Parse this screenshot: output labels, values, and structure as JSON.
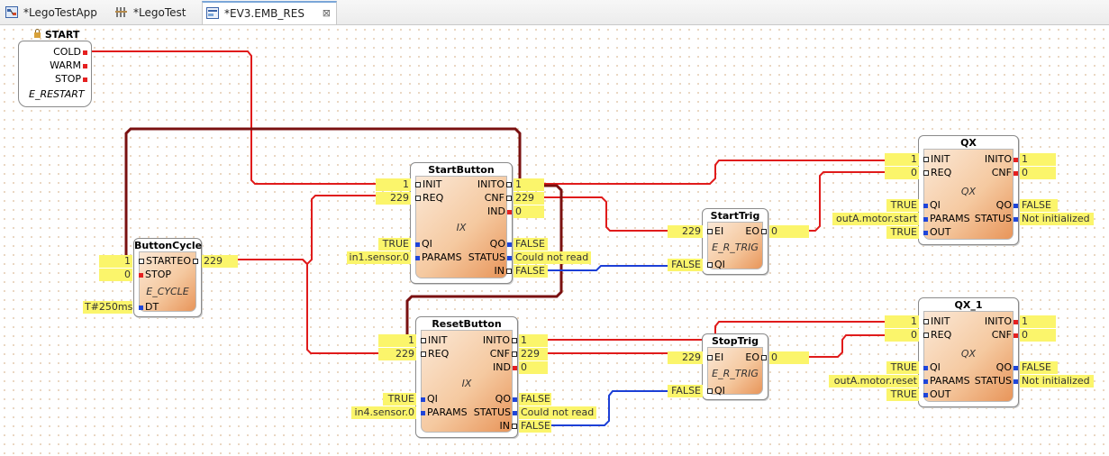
{
  "tabs": [
    {
      "label": "*LegoTestApp",
      "icon": "application-icon"
    },
    {
      "label": "*LegoTest",
      "icon": "system-icon"
    },
    {
      "label": "*EV3.EMB_RES",
      "icon": "resource-icon",
      "close": "⊠"
    }
  ],
  "start_block": {
    "title": "START",
    "ports": [
      "COLD",
      "WARM",
      "STOP"
    ],
    "type": "E_RESTART"
  },
  "blocks": {
    "button_cycle": {
      "title": "ButtonCycle",
      "type": "E_CYCLE",
      "inputs": [
        "START",
        "STOP",
        "DT"
      ],
      "outputs": [
        "EO"
      ],
      "values": {
        "start": "1",
        "stop": "0",
        "dt": "T#250ms",
        "eo": "229"
      }
    },
    "start_button": {
      "title": "StartButton",
      "type": "IX",
      "inputs": [
        "INIT",
        "REQ",
        "QI",
        "PARAMS"
      ],
      "outputs": [
        "INITO",
        "CNF",
        "IND",
        "QO",
        "STATUS",
        "IN"
      ],
      "values": {
        "init": "1",
        "req": "229",
        "qi": "TRUE",
        "params": "in1.sensor.0",
        "inito": "1",
        "cnf": "229",
        "ind": "0",
        "qo": "FALSE",
        "status": "Could not read",
        "in": "FALSE"
      }
    },
    "reset_button": {
      "title": "ResetButton",
      "type": "IX",
      "inputs": [
        "INIT",
        "REQ",
        "QI",
        "PARAMS"
      ],
      "outputs": [
        "INITO",
        "CNF",
        "IND",
        "QO",
        "STATUS",
        "IN"
      ],
      "values": {
        "init": "1",
        "req": "229",
        "qi": "TRUE",
        "params": "in4.sensor.0",
        "inito": "1",
        "cnf": "229",
        "ind": "0",
        "qo": "FALSE",
        "status": "Could not read",
        "in": "FALSE"
      }
    },
    "start_trig": {
      "title": "StartTrig",
      "type": "E_R_TRIG",
      "inputs": [
        "EI",
        "QI"
      ],
      "outputs": [
        "EO"
      ],
      "values": {
        "ei": "229",
        "qi": "FALSE",
        "eo": "0"
      }
    },
    "stop_trig": {
      "title": "StopTrig",
      "type": "E_R_TRIG",
      "inputs": [
        "EI",
        "QI"
      ],
      "outputs": [
        "EO"
      ],
      "values": {
        "ei": "229",
        "qi": "FALSE",
        "eo": "0"
      }
    },
    "qx": {
      "title": "QX",
      "type": "QX",
      "inputs": [
        "INIT",
        "REQ",
        "QI",
        "PARAMS",
        "OUT"
      ],
      "outputs": [
        "INITO",
        "CNF",
        "QO",
        "STATUS"
      ],
      "values": {
        "init": "1",
        "req": "0",
        "qi": "TRUE",
        "params": "outA.motor.start",
        "out": "TRUE",
        "inito": "1",
        "cnf": "0",
        "qo": "FALSE",
        "status": "Not initialized"
      }
    },
    "qx_1": {
      "title": "QX_1",
      "type": "QX",
      "inputs": [
        "INIT",
        "REQ",
        "QI",
        "PARAMS",
        "OUT"
      ],
      "outputs": [
        "INITO",
        "CNF",
        "QO",
        "STATUS"
      ],
      "values": {
        "init": "1",
        "req": "0",
        "qi": "TRUE",
        "params": "outA.motor.reset",
        "out": "TRUE",
        "inito": "1",
        "cnf": "0",
        "qo": "FALSE",
        "status": "Not initialized"
      }
    }
  },
  "colors": {
    "event_connection": "#e01b1b",
    "data_connection": "#1c3fd6",
    "value_highlight": "#fbf56b",
    "block_fill": "#f5c9a0"
  }
}
